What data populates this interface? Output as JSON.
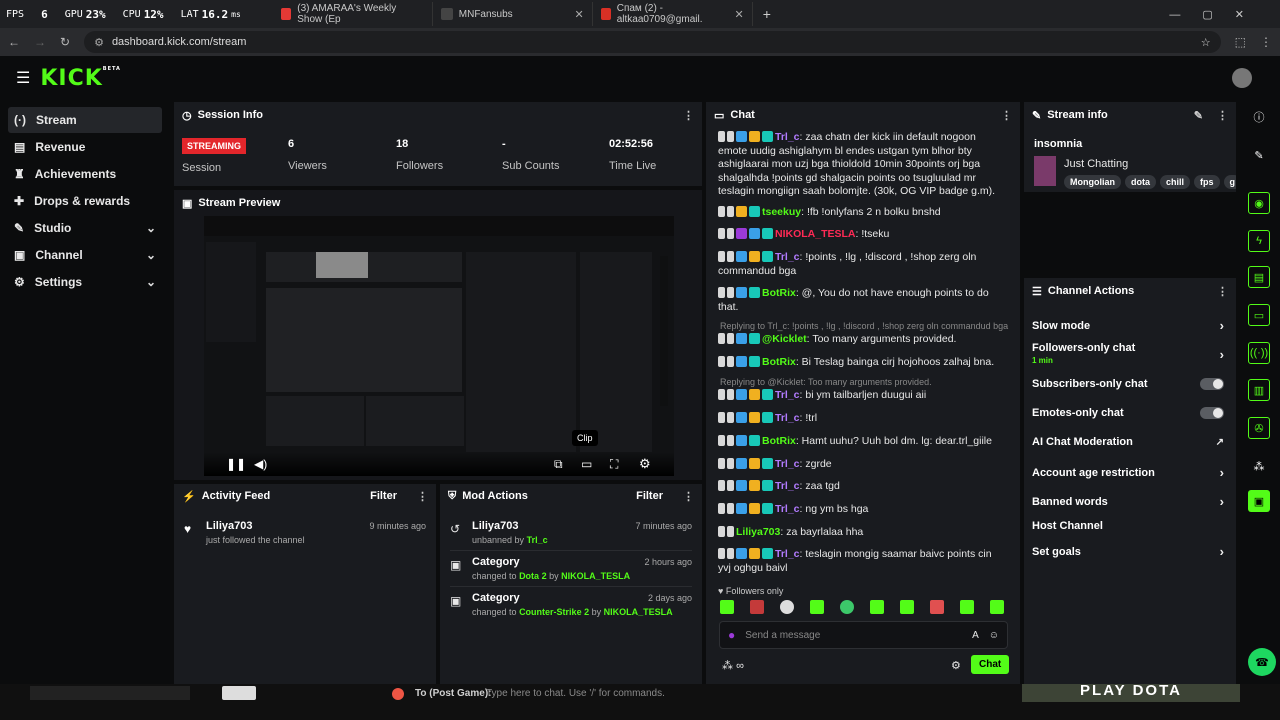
{
  "overlay": {
    "fps_label": "FPS",
    "fps_value": "6",
    "gpu_label": "GPU",
    "gpu_value": "23%",
    "cpu_label": "CPU",
    "cpu_value": "12%",
    "lat_label": "LAT",
    "lat_value": "16.2",
    "lat_unit": "ms"
  },
  "tabs": [
    {
      "title": "(3) AMARAA's Weekly Show (Ep"
    },
    {
      "title": "MNFansubs"
    },
    {
      "title": "Спам (2) - altkaa0709@gmail."
    }
  ],
  "browser": {
    "url": "dashboard.kick.com/stream"
  },
  "brand": {
    "logo": "KICK",
    "beta": "BETA",
    "accent": "#53fc18"
  },
  "sidebar": {
    "items": [
      {
        "label": "Stream"
      },
      {
        "label": "Revenue"
      },
      {
        "label": "Achievements"
      },
      {
        "label": "Drops & rewards"
      },
      {
        "label": "Studio"
      },
      {
        "label": "Channel"
      },
      {
        "label": "Settings"
      }
    ]
  },
  "session": {
    "title": "Session Info",
    "status": "STREAMING",
    "status_label": "Session",
    "viewers": "6",
    "viewers_label": "Viewers",
    "followers": "18",
    "followers_label": "Followers",
    "subs": "-",
    "subs_label": "Sub Counts",
    "time": "02:52:56",
    "time_label": "Time Live"
  },
  "preview": {
    "title": "Stream Preview",
    "tooltip": "Clip"
  },
  "activity": {
    "title": "Activity Feed",
    "filter": "Filter",
    "items": [
      {
        "user": "Liliya703",
        "action": "just followed the channel",
        "time": "9 minutes ago"
      }
    ]
  },
  "mod": {
    "title": "Mod Actions",
    "filter": "Filter",
    "items": [
      {
        "user": "Liliya703",
        "pre": "unbanned by",
        "target": "Trl_c",
        "time": "7 minutes ago"
      },
      {
        "user": "Category",
        "pre": "changed to",
        "target": "Dota 2",
        "by": "by",
        "actor": "NIKOLA_TESLA",
        "time": "2 hours ago"
      },
      {
        "user": "Category",
        "pre": "changed to",
        "target": "Counter-Strike 2",
        "by": "by",
        "actor": "NIKOLA_TESLA",
        "time": "2 days ago"
      }
    ]
  },
  "chat": {
    "title": "Chat",
    "messages": [
      {
        "user": "Trl_c",
        "text": ": zaa chatn der kick iin default nogoon emote uudig ashiglahym bl endes ustgan tym blhor bty ashiglaarai mon uzj bga thioldold 10min 30points orj bga shalgalhda !points gd shalgacin points oo tsugluulad mr teslagin mongiign saah bolomjte. (30k, OG VIP badge g.m)."
      },
      {
        "user": "tseekuy",
        "text": ": !fb !onlyfans 2 n bolku bnshd"
      },
      {
        "user": "NIKOLA_TESLA",
        "text": ": !tseku"
      },
      {
        "user": "Trl_c",
        "text": ": !points , !lg , !discord , !shop zerg oln commandud bga"
      },
      {
        "user": "BotRix",
        "text": ": @, You do not have enough points to do that."
      },
      {
        "reply": "Replying to Trl_c: !points , !lg , !discord , !shop zerg oln commandud bga"
      },
      {
        "user": "@Kicklet",
        "text": ": Too many arguments provided."
      },
      {
        "user": "BotRix",
        "text": ": Bi Teslag bainga cirj hojohoos zalhaj bna."
      },
      {
        "reply": "Replying to @Kicklet: Too many arguments provided."
      },
      {
        "user": "Trl_c",
        "text": ": bi ym tailbarljen duugui aii"
      },
      {
        "user": "Trl_c",
        "text": ": !trl"
      },
      {
        "user": "BotRix",
        "text": ": Hamt uuhu? Uuh bol dm. lg: dear.trl_giile"
      },
      {
        "user": "Trl_c",
        "text": ": zgrde"
      },
      {
        "user": "Trl_c",
        "text": ": zaa tgd"
      },
      {
        "user": "Trl_c",
        "text": ": ng ym bs hga"
      },
      {
        "user": "Liliya703",
        "text": ": za bayrlalaa hha"
      },
      {
        "user": "Trl_c",
        "text": ": teslagin mongig saamar baivc points cin yvj oghgu baivl"
      }
    ],
    "mode": "Followers only",
    "placeholder": "Send a message",
    "send": "Chat",
    "infinity": "∞"
  },
  "streaminfo": {
    "title": "Stream info",
    "name": "insomnia",
    "category": "Just Chatting",
    "tags": [
      "Mongolian",
      "dota",
      "chill",
      "fps",
      "g"
    ]
  },
  "channel_actions": {
    "title": "Channel Actions",
    "items": [
      {
        "label": "Slow mode"
      },
      {
        "label": "Followers-only chat",
        "sub": "1 min"
      },
      {
        "label": "Subscribers-only chat"
      },
      {
        "label": "Emotes-only chat"
      },
      {
        "label": "AI Chat Moderation"
      },
      {
        "label": "Account age restriction"
      },
      {
        "label": "Banned words"
      },
      {
        "label": "Host Channel"
      },
      {
        "label": "Set goals"
      }
    ]
  },
  "game": {
    "to": "To (Post Game):",
    "placeholder": "Type here to chat. Use '/' for commands.",
    "banner": "PLAY DOTA"
  }
}
